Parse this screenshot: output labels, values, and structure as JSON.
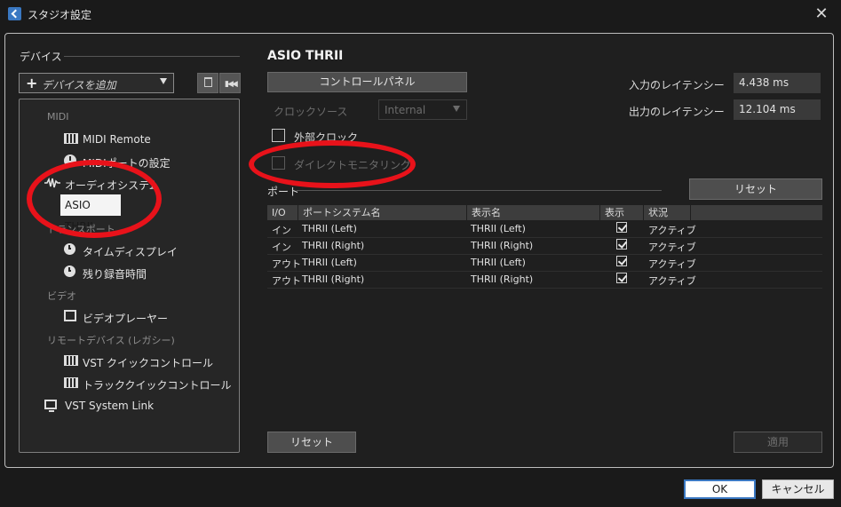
{
  "window": {
    "title": "スタジオ設定",
    "close_glyph": "✕"
  },
  "sidebar": {
    "section_title": "デバイス",
    "add_device_label": "デバイスを追加",
    "categories": {
      "midi": "MIDI",
      "transport": "トランスポート",
      "video": "ビデオ",
      "remote": "リモートデバイス (レガシー)"
    },
    "items": {
      "midi_remote": "MIDI Remote",
      "midi_port": "MIDIポートの設定",
      "audio_system": "オーディオシステム",
      "asio": "ASIO THRII",
      "time_display": "タイムディスプレイ",
      "rec_time": "残り録音時間",
      "video_player": "ビデオプレーヤー",
      "vst_quick": "VST クイックコントロール",
      "track_quick": "トラッククイックコントロール",
      "vst_link": "VST System Link"
    }
  },
  "main": {
    "device_title": "ASIO THRII",
    "control_panel": "コントロールパネル",
    "clock_source_label": "クロックソース",
    "clock_source_value": "Internal",
    "external_clock": "外部クロック",
    "direct_monitoring": "ダイレクトモニタリング",
    "input_latency_label": "入力のレイテンシー",
    "input_latency_value": "4.438 ms",
    "output_latency_label": "出力のレイテンシー",
    "output_latency_value": "12.104 ms",
    "ports_label": "ポート",
    "reset_ports": "リセット",
    "table": {
      "headers": [
        "I/O",
        "ポートシステム名",
        "表示名",
        "表示",
        "状況"
      ],
      "rows": [
        {
          "io": "イン",
          "system": "THRII (Left)",
          "display": "THRII (Left)",
          "status": "アクティブ"
        },
        {
          "io": "イン",
          "system": "THRII (Right)",
          "display": "THRII (Right)",
          "status": "アクティブ"
        },
        {
          "io": "アウト",
          "system": "THRII (Left)",
          "display": "THRII (Left)",
          "status": "アクティブ"
        },
        {
          "io": "アウト",
          "system": "THRII (Right)",
          "display": "THRII (Right)",
          "status": "アクティブ"
        }
      ]
    },
    "reset_bottom": "リセット",
    "apply": "適用"
  },
  "footer": {
    "ok": "OK",
    "cancel": "キャンセル"
  },
  "colors": {
    "annotation": "#e8121a",
    "accent": "#3a78c2"
  }
}
